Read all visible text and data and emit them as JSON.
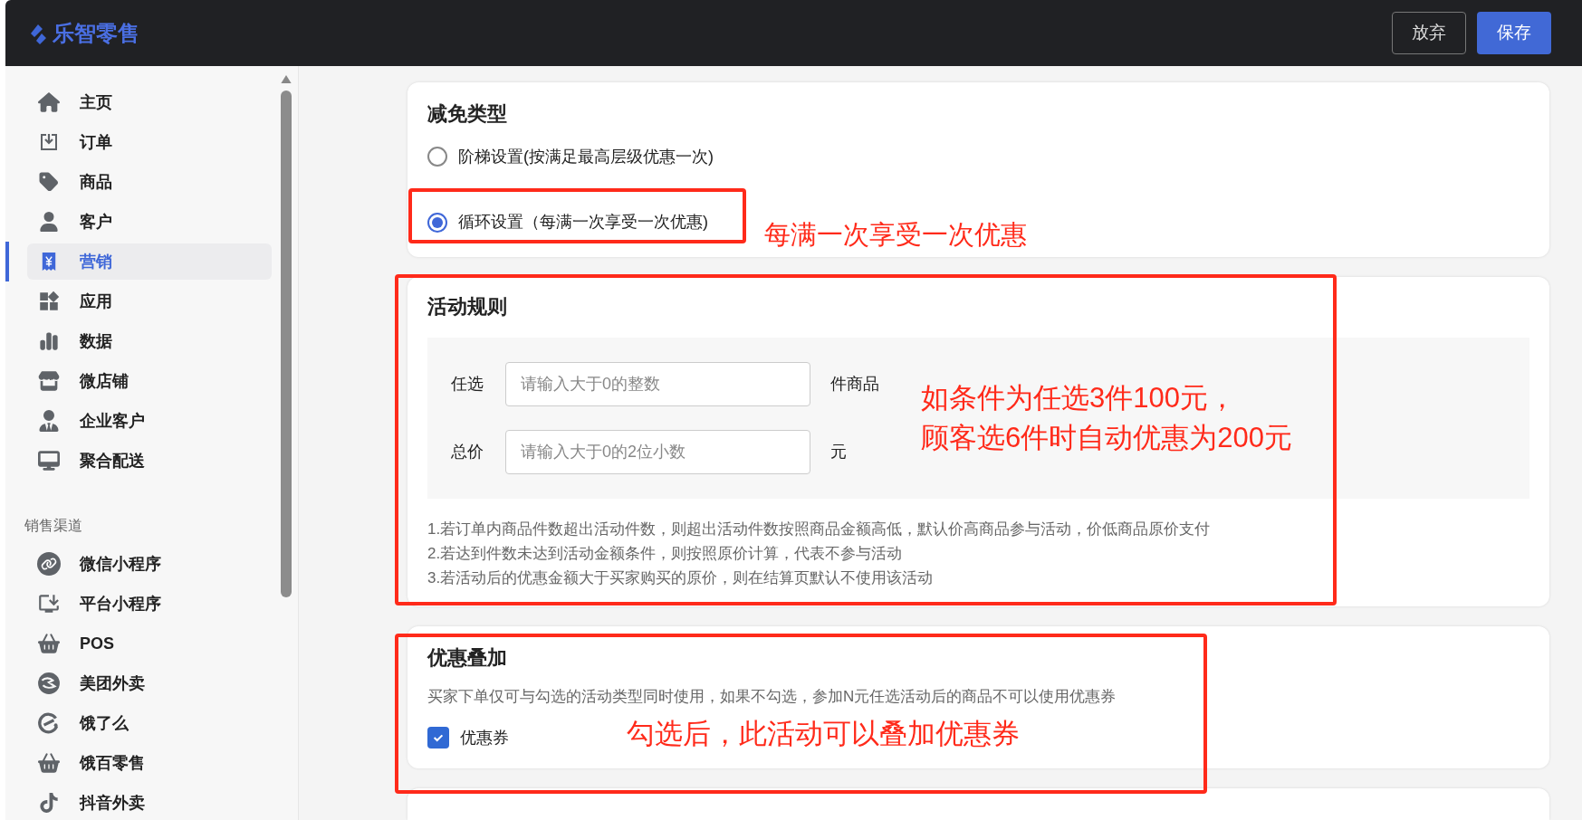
{
  "header": {
    "logo": "乐智零售",
    "buttons": [
      {
        "label": "放弃",
        "kind": "secondary"
      },
      {
        "label": "保存",
        "kind": "primary"
      }
    ]
  },
  "sidebar": {
    "items": [
      {
        "label": "主页",
        "selected": false
      },
      {
        "label": "订单",
        "selected": false
      },
      {
        "label": "商品",
        "selected": false
      },
      {
        "label": "客户",
        "selected": false
      },
      {
        "label": "营销",
        "selected": true
      },
      {
        "label": "应用",
        "selected": false
      },
      {
        "label": "数据",
        "selected": false
      },
      {
        "label": "微店铺",
        "selected": false
      },
      {
        "label": "企业客户",
        "selected": false
      },
      {
        "label": "聚合配送",
        "selected": false
      }
    ],
    "channels_title": "销售渠道",
    "channels": [
      {
        "label": "微信小程序",
        "selected": false
      },
      {
        "label": "平台小程序",
        "selected": false
      },
      {
        "label": "POS",
        "selected": false
      },
      {
        "label": "美团外卖",
        "selected": false
      },
      {
        "label": "饿了么",
        "selected": false
      },
      {
        "label": "饿百零售",
        "selected": false
      },
      {
        "label": "抖音外卖",
        "selected": false
      }
    ]
  },
  "discount_type": {
    "title": "减免类型",
    "options": [
      {
        "label": "阶梯设置(按满足最高层级优惠一次)",
        "selected": false
      },
      {
        "label": "循环设置（每满一次享受一次优惠)",
        "selected": true
      }
    ],
    "annotation": "每满一次享受一次优惠"
  },
  "rules": {
    "title": "活动规则",
    "fields": [
      {
        "label": "任选",
        "placeholder": "请输入大于0的整数",
        "unit": "件商品"
      },
      {
        "label": "总价",
        "placeholder": "请输入大于0的2位小数",
        "unit": "元"
      }
    ],
    "annotation": [
      "如条件为任选3件100元，",
      "顾客选6件时自动优惠为200元"
    ],
    "notes": [
      "1.若订单内商品件数超出活动件数，则超出活动件数按照商品金额高低，默认价高商品参与活动，价低商品原价支付",
      "2.若达到件数未达到活动金额条件，则按照原价计算，代表不参与活动",
      "3.若活动后的优惠金额大于买家购买的原价，则在结算页默认不使用该活动"
    ]
  },
  "stacking": {
    "title": "优惠叠加",
    "description": "买家下单仅可与勾选的活动类型同时使用，如果不勾选，参加N元任选活动后的商品不可以使用优惠券",
    "options": [
      {
        "label": "优惠券",
        "checked": true
      }
    ],
    "annotation": "勾选后，此活动可以叠加优惠券"
  }
}
